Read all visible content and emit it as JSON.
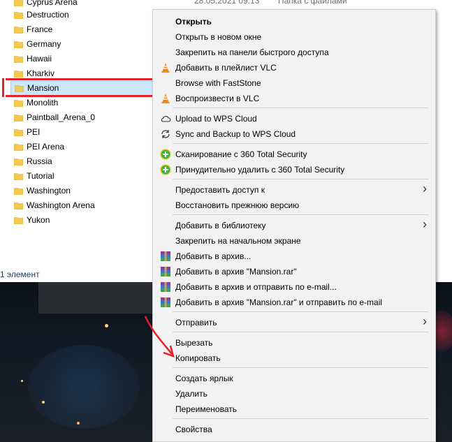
{
  "explorer": {
    "header_row": {
      "name": "Cyprus Arena",
      "date": "28.05.2021 09:13",
      "type": "Папка с файлами"
    },
    "folders": [
      "Destruction",
      "France",
      "Germany",
      "Hawaii",
      "Kharkiv",
      "Mansion",
      "Monolith",
      "Paintball_Arena_0",
      "PEI",
      "PEI Arena",
      "Russia",
      "Tutorial",
      "Washington",
      "Washington Arena",
      "Yukon"
    ],
    "selected": "Mansion",
    "status": "1 элемент"
  },
  "context_menu": {
    "groups": [
      [
        {
          "label": "Открыть",
          "bold": true,
          "icon": ""
        },
        {
          "label": "Открыть в новом окне",
          "icon": ""
        },
        {
          "label": "Закрепить на панели быстрого доступа",
          "icon": ""
        },
        {
          "label": "Добавить в плейлист VLC",
          "icon": "vlc-cone-icon"
        },
        {
          "label": "Browse with FastStone",
          "icon": ""
        },
        {
          "label": "Воспроизвести в VLC",
          "icon": "vlc-cone-icon"
        }
      ],
      [
        {
          "label": "Upload to WPS Cloud",
          "icon": "cloud-icon"
        },
        {
          "label": "Sync and Backup to WPS Cloud",
          "icon": "sync-icon"
        }
      ],
      [
        {
          "label": "Сканирование с 360 Total Security",
          "icon": "360-security-icon"
        },
        {
          "label": "Принудительно удалить с  360 Total Security",
          "icon": "360-security-icon"
        }
      ],
      [
        {
          "label": "Предоставить доступ к",
          "icon": "",
          "submenu": true
        },
        {
          "label": "Восстановить прежнюю версию",
          "icon": ""
        }
      ],
      [
        {
          "label": "Добавить в библиотеку",
          "icon": "",
          "submenu": true
        },
        {
          "label": "Закрепить на начальном экране",
          "icon": ""
        },
        {
          "label": "Добавить в архив...",
          "icon": "winrar-icon"
        },
        {
          "label": "Добавить в архив \"Mansion.rar\"",
          "icon": "winrar-icon"
        },
        {
          "label": "Добавить в архив и отправить по e-mail...",
          "icon": "winrar-icon"
        },
        {
          "label": "Добавить в архив \"Mansion.rar\" и отправить по e-mail",
          "icon": "winrar-icon"
        }
      ],
      [
        {
          "label": "Отправить",
          "icon": "",
          "submenu": true
        }
      ],
      [
        {
          "label": "Вырезать",
          "icon": ""
        },
        {
          "label": "Копировать",
          "icon": ""
        }
      ],
      [
        {
          "label": "Создать ярлык",
          "icon": ""
        },
        {
          "label": "Удалить",
          "icon": ""
        },
        {
          "label": "Переименовать",
          "icon": ""
        }
      ],
      [
        {
          "label": "Свойства",
          "icon": ""
        }
      ]
    ]
  },
  "colors": {
    "selection": "#cce8ff",
    "annotation": "#e3202a",
    "menu_bg": "#f2f2f2",
    "folder": "#f4c94f"
  }
}
